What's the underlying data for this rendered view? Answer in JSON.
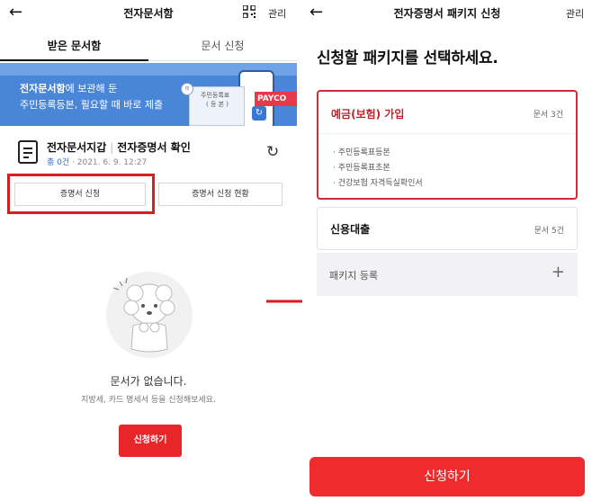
{
  "left": {
    "title": "전자문서함",
    "manage_label": "관리",
    "tabs": [
      {
        "label": "받은 문서함",
        "active": true
      },
      {
        "label": "문서 신청",
        "active": false
      }
    ],
    "banner": {
      "line1_bold": "전자문서함",
      "line1_rest": "에 보관해 둔",
      "line2": "주민등록등본, 필요할 때 바로 제출",
      "paper_label1": "주민등록표",
      "paper_label2": "( 등 본 )",
      "payco_text": "PAYCO"
    },
    "wallet": {
      "title": "전자문서지갑",
      "subtitle": "전자증명서 확인",
      "count_text": "총 0건",
      "date_text": "· 2021. 6. 9. 12:27"
    },
    "buttons": {
      "apply_cert": "증명서 신청",
      "cert_status": "증명서 신청 현황"
    },
    "empty": {
      "title": "문서가 없습니다.",
      "desc": "지방세, 카드 명세서 등을 신청해보세요.",
      "apply_label": "신청하기"
    }
  },
  "right": {
    "title": "전자증명서 패키지 신청",
    "manage_label": "관리",
    "headline": "신청할 패키지를 선택하세요.",
    "packages": [
      {
        "name": "예금(보험) 가입",
        "count": "문서 3건",
        "selected": true,
        "documents": [
          "주민등록표등본",
          "주민등록표초본",
          "건강보험 자격득실확인서"
        ]
      },
      {
        "name": "신용대출",
        "count": "문서 5건",
        "selected": false
      }
    ],
    "add_package_label": "패키지 등록",
    "apply_label": "신청하기"
  },
  "colors": {
    "accent_red": "#ef2b2d",
    "banner_blue": "#4a86d8",
    "highlight_red": "#d91e1e"
  }
}
